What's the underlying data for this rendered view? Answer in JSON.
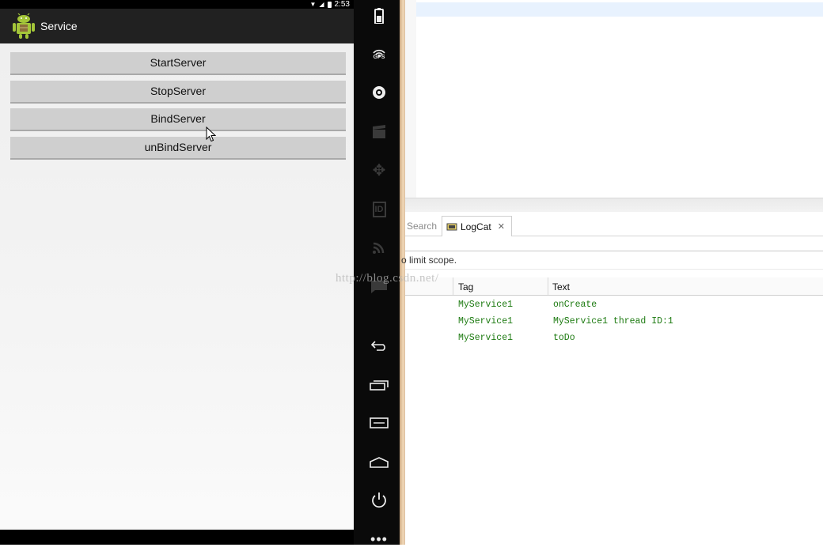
{
  "status_bar": {
    "time": "2:53"
  },
  "app": {
    "title": "Service"
  },
  "buttons": [
    {
      "label": "StartServer"
    },
    {
      "label": "StopServer"
    },
    {
      "label": "BindServer"
    },
    {
      "label": "unBindServer"
    }
  ],
  "emulator_controls": [
    {
      "icon": "battery-icon"
    },
    {
      "icon": "gps-icon",
      "label": "GPS"
    },
    {
      "icon": "camera-icon"
    },
    {
      "icon": "video-icon"
    },
    {
      "icon": "dpad-icon"
    },
    {
      "icon": "id-icon",
      "label": "ID"
    },
    {
      "icon": "rss-icon"
    },
    {
      "icon": "sms-icon"
    },
    {
      "icon": "back-icon"
    },
    {
      "icon": "recents-icon"
    },
    {
      "icon": "menu-icon"
    },
    {
      "icon": "home-icon"
    },
    {
      "icon": "power-icon"
    },
    {
      "icon": "more-icon"
    }
  ],
  "ide": {
    "tabs": {
      "search": "Search",
      "logcat": "LogCat"
    },
    "filter_hint": "o limit scope.",
    "log_headers": {
      "tag": "Tag",
      "text": "Text"
    },
    "log_rows": [
      {
        "tag": "MyService1",
        "text": "onCreate"
      },
      {
        "tag": "MyService1",
        "text": "MyService1 thread ID:1"
      },
      {
        "tag": "MyService1",
        "text": "toDo"
      }
    ]
  },
  "watermark": "http://blog.csdn.net/",
  "colors": {
    "log_green": "#1c7a10",
    "action_bar": "#212121",
    "button_gray": "#cfcfcf"
  }
}
